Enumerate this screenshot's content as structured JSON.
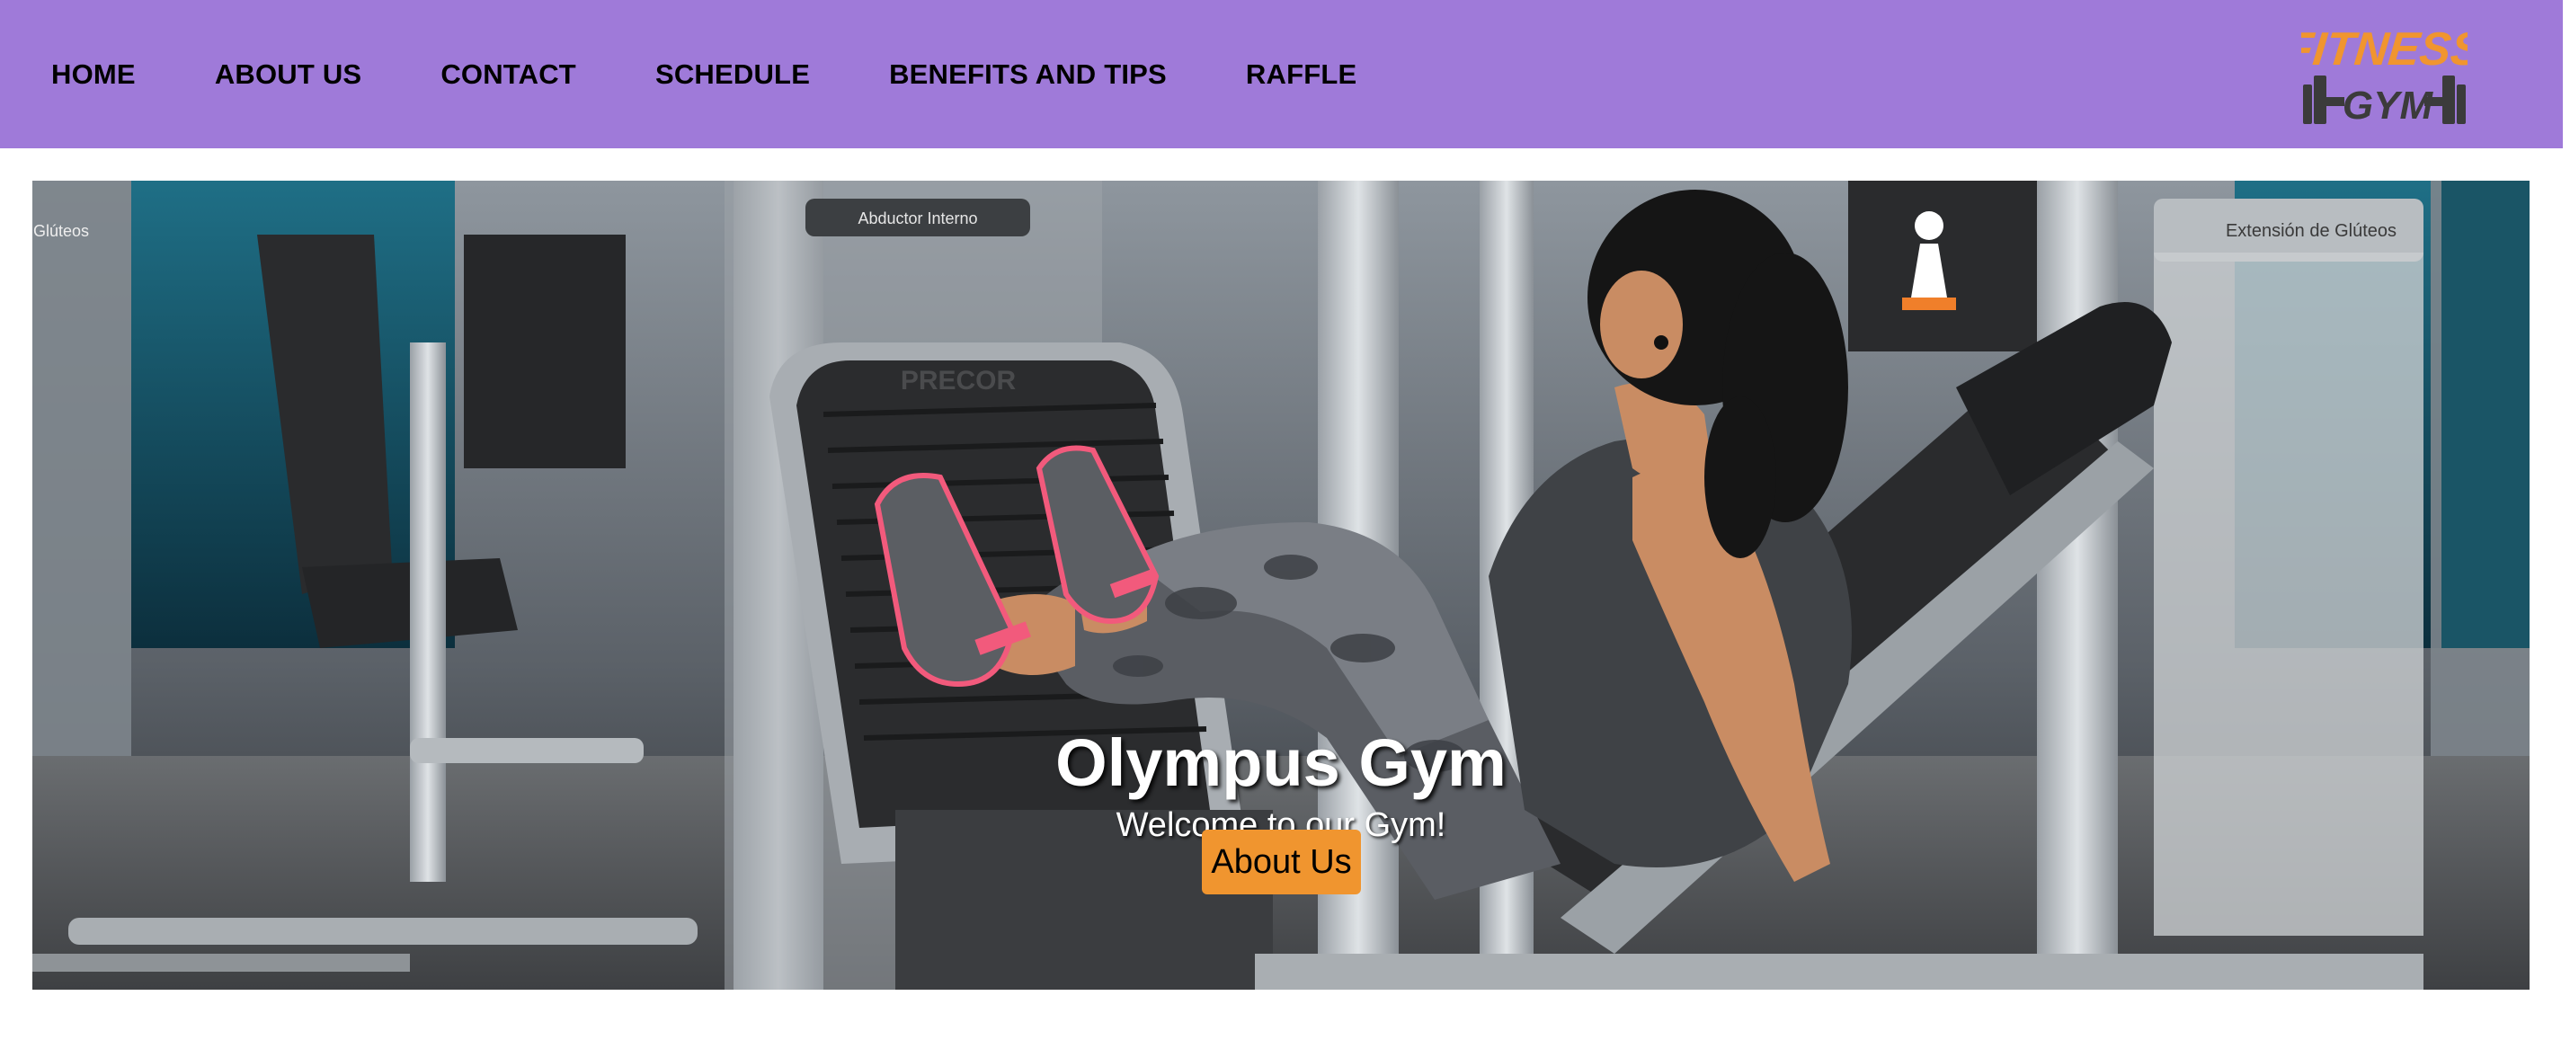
{
  "nav": {
    "items": [
      {
        "label": "HOME"
      },
      {
        "label": "ABOUT US"
      },
      {
        "label": "CONTACT"
      },
      {
        "label": "SCHEDULE"
      },
      {
        "label": "BENEFITS AND TIPS"
      },
      {
        "label": "RAFFLE"
      }
    ],
    "background_color": "#9f7ad9"
  },
  "logo": {
    "line1": "FITNESS",
    "line2": "GYM",
    "color_primary": "#f0952f",
    "color_secondary": "#3b3b3b",
    "icon": "dumbbell-icon"
  },
  "hero": {
    "title": "Olympus Gym",
    "subtitle": "Welcome to our Gym!",
    "button_label": "About Us",
    "button_color": "#f0952f",
    "photo_signs": {
      "left": "Glúteos",
      "center": "Abductor Interno",
      "right": "Extensión de Glúteos",
      "brand": "PRECOR"
    }
  }
}
